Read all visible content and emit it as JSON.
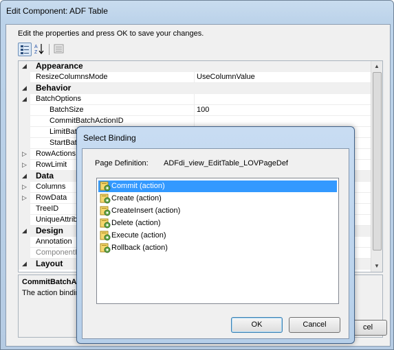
{
  "outer": {
    "title": "Edit Component: ADF Table",
    "instruction": "Edit the properties and press OK to save your changes.",
    "toolbar": [
      "categorized-icon",
      "alphabetical-sort-icon",
      "property-pages-icon"
    ],
    "properties": [
      {
        "kind": "cat",
        "name": "Appearance",
        "expander": "◢"
      },
      {
        "kind": "prop",
        "level": 1,
        "name": "ResizeColumnsMode",
        "value": "UseColumnValue"
      },
      {
        "kind": "cat",
        "name": "Behavior",
        "expander": "◢"
      },
      {
        "kind": "prop",
        "level": 1,
        "name": "BatchOptions",
        "expander": "◢",
        "value": ""
      },
      {
        "kind": "prop",
        "level": 2,
        "name": "BatchSize",
        "value": "100"
      },
      {
        "kind": "prop",
        "level": 2,
        "name": "CommitBatchActionID",
        "value": ""
      },
      {
        "kind": "prop",
        "level": 2,
        "name": "LimitBatch",
        "value": ""
      },
      {
        "kind": "prop",
        "level": 2,
        "name": "StartBatc",
        "value": ""
      },
      {
        "kind": "prop",
        "level": 1,
        "name": "RowActions",
        "expander": "▷",
        "value": ""
      },
      {
        "kind": "prop",
        "level": 1,
        "name": "RowLimit",
        "expander": "▷",
        "value": ""
      },
      {
        "kind": "cat",
        "name": "Data",
        "expander": "◢"
      },
      {
        "kind": "prop",
        "level": 1,
        "name": "Columns",
        "expander": "▷",
        "value": ""
      },
      {
        "kind": "prop",
        "level": 1,
        "name": "RowData",
        "expander": "▷",
        "value": ""
      },
      {
        "kind": "prop",
        "level": 1,
        "name": "TreeID",
        "value": ""
      },
      {
        "kind": "prop",
        "level": 1,
        "name": "UniqueAttribu",
        "value": ""
      },
      {
        "kind": "cat",
        "name": "Design",
        "expander": "◢"
      },
      {
        "kind": "prop",
        "level": 1,
        "name": "Annotation",
        "value": ""
      },
      {
        "kind": "prop",
        "level": 1,
        "name": "ComponentID",
        "value": "",
        "gray": true
      },
      {
        "kind": "cat",
        "name": "Layout",
        "expander": "◢"
      }
    ],
    "description": {
      "title": "CommitBatchAc",
      "text": "The action binding"
    },
    "cancel_fragment": "cel"
  },
  "dialog": {
    "title": "Select Binding",
    "page_definition_label": "Page Definition:",
    "page_definition_value": "ADFdi_view_EditTable_LOVPageDef",
    "bindings": [
      {
        "label": "Commit (action)",
        "selected": true
      },
      {
        "label": "Create (action)",
        "selected": false
      },
      {
        "label": "CreateInsert (action)",
        "selected": false
      },
      {
        "label": "Delete (action)",
        "selected": false
      },
      {
        "label": "Execute (action)",
        "selected": false
      },
      {
        "label": "Rollback (action)",
        "selected": false
      }
    ],
    "ok_label": "OK",
    "cancel_label": "Cancel"
  },
  "colors": {
    "selection": "#3399ff",
    "title_gradient_top": "#c8dcf2"
  }
}
